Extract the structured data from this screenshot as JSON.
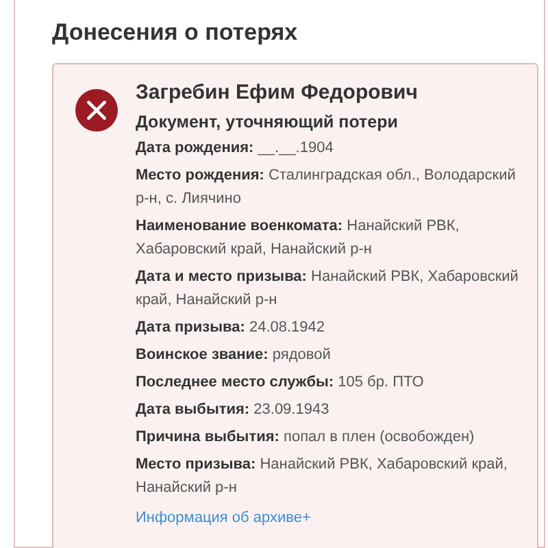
{
  "section_title": "Донесения о потерях",
  "record": {
    "kind": "error",
    "name": "Загребин Ефим Федорович",
    "document_type": "Документ, уточняющий потери",
    "fields": [
      "**Дата рождения:** __.__.1904",
      "**Место рождения:** Сталинградская обл., Володарский р-н, с. Лиячино",
      "**Наименование военкомата:** Нанайский РВК, Хабаровский край, Нанайский р-н",
      "**Дата и место призыва:** Нанайский РВК, Хабаровский край, Нанайский р-н",
      "**Дата призыва:** 24.08.1942",
      "**Воинское звание:** рядовой",
      "**Последнее место службы:** 105 бр. ПТО",
      "**Дата выбытия:** 23.09.1943",
      "**Причина выбытия:** попал в плен (освобожден)",
      "**Место призыва:** Нанайский РВК, Хабаровский край, Нанайский р-н"
    ],
    "archive_link": "Информация об архиве+"
  }
}
